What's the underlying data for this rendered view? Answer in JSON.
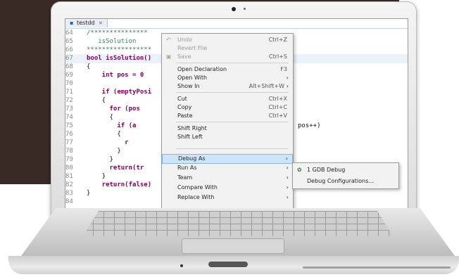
{
  "editor": {
    "tab_label": "testdd",
    "tab_close": "✕",
    "lines": [
      {
        "num": "64",
        "text": "/***************"
      },
      {
        "num": "65",
        "text": "   isSolution"
      },
      {
        "num": "66",
        "text": "*****************"
      },
      {
        "num": "67",
        "text": "bool isSolution()"
      },
      {
        "num": "68",
        "text": "{"
      },
      {
        "num": "69",
        "text": "    int pos = 0"
      },
      {
        "num": "70",
        "text": ""
      },
      {
        "num": "71",
        "text": "    if (emptyPosi"
      },
      {
        "num": "72",
        "text": "    {"
      },
      {
        "num": "73",
        "text": "      for (pos"
      },
      {
        "num": "74",
        "text": "      {"
      },
      {
        "num": "75",
        "text": "        if (a"
      },
      {
        "num": "76",
        "text": "        {"
      },
      {
        "num": "77",
        "text": "          r"
      },
      {
        "num": "78",
        "text": "        }"
      },
      {
        "num": "79",
        "text": "      }"
      },
      {
        "num": "80",
        "text": "      return(tr"
      },
      {
        "num": "81",
        "text": "    }"
      },
      {
        "num": "82",
        "text": "    return(false)"
      },
      {
        "num": "83",
        "text": "}"
      },
      {
        "num": "84",
        "text": ""
      }
    ],
    "right_code": "pos++)"
  },
  "context_menu": {
    "items": [
      {
        "label": "Undo",
        "shortcut": "Ctrl+Z",
        "disabled": true
      },
      {
        "label": "Revert File",
        "shortcut": "",
        "disabled": true
      },
      {
        "label": "Save",
        "shortcut": "Ctrl+S",
        "disabled": true
      },
      {
        "label": "Open Declaration",
        "shortcut": "F3"
      },
      {
        "label": "Open With",
        "shortcut": "",
        "arrow": true
      },
      {
        "label": "Show In",
        "shortcut": "Alt+Shift+W",
        "arrow": true
      },
      {
        "label": "Cut",
        "shortcut": "Ctrl+X"
      },
      {
        "label": "Copy",
        "shortcut": "Ctrl+C"
      },
      {
        "label": "Paste",
        "shortcut": "Ctrl+V"
      },
      {
        "label": "Shift Right",
        "shortcut": ""
      },
      {
        "label": "Shift Left",
        "shortcut": ""
      },
      {
        "label": "Debug As",
        "shortcut": "",
        "arrow": true,
        "selected": true
      },
      {
        "label": "Run As",
        "shortcut": "",
        "arrow": true
      },
      {
        "label": "Team",
        "shortcut": "",
        "arrow": true
      },
      {
        "label": "Compare With",
        "shortcut": "",
        "arrow": true
      },
      {
        "label": "Replace With",
        "shortcut": "",
        "arrow": true
      }
    ],
    "arrow_glyph": "›"
  },
  "submenu": {
    "items": [
      {
        "label": "1 GDB Debug",
        "icon": "debug-icon"
      },
      {
        "label": "Debug Configurations..."
      }
    ]
  },
  "colors": {
    "background_dark": "#3a2a26",
    "selection": "#cde4fb"
  }
}
